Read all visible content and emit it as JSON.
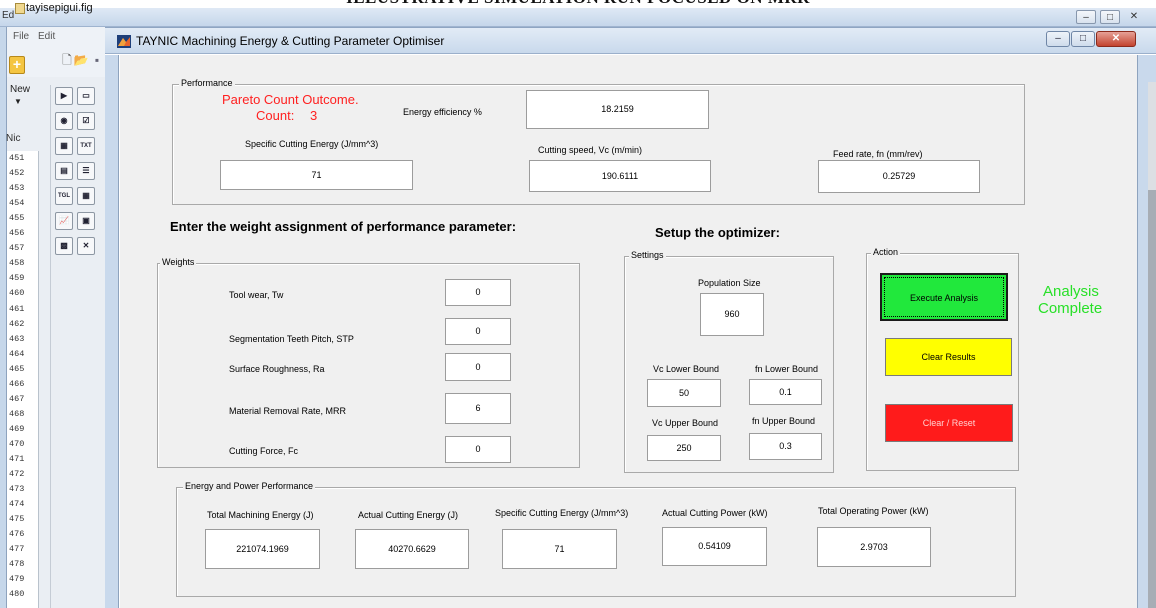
{
  "banner": {
    "text": "ILLUSTRATIVE SIMULATION RUN FOCUSED ON MRR"
  },
  "guide_window": {
    "title": "tayisepigui.fig",
    "corner_label": "Ed",
    "menu": [
      "File",
      "Edit"
    ],
    "new_label": "New",
    "nic_label": "Nic",
    "line_numbers": [
      "451",
      "452",
      "453",
      "454",
      "455",
      "456",
      "457",
      "458",
      "459",
      "460",
      "461",
      "462",
      "463",
      "464",
      "465",
      "466",
      "467",
      "468",
      "469",
      "470",
      "471",
      "472",
      "473",
      "474",
      "475",
      "476",
      "477",
      "478",
      "479",
      "480"
    ],
    "palette_icons": [
      "push-button-icon",
      "slider-icon",
      "radio-button-icon",
      "check-box-icon",
      "edit-text-icon",
      "static-text-icon",
      "popup-menu-icon",
      "listbox-icon",
      "toggle-button-icon",
      "table-icon",
      "axes-icon",
      "panel-icon",
      "button-group-icon",
      "activex-icon"
    ]
  },
  "app": {
    "title": "TAYNIC Machining Energy & Cutting Parameter Optimiser",
    "performance": {
      "panel_title": "Performance",
      "pareto_line1": "Pareto Count Outcome.",
      "pareto_line2_label": "Count:",
      "pareto_count": "3",
      "energy_efficiency_label": "Energy efficiency  %",
      "energy_efficiency_value": "18.2159",
      "specific_cutting_energy_label": "Specific Cutting Energy (J/mm^3)",
      "specific_cutting_energy_value": "71",
      "cutting_speed_label": "Cutting speed, Vc   (m/min)",
      "cutting_speed_value": "190.6111",
      "feed_rate_label": "Feed rate, fn   (mm/rev)",
      "feed_rate_value": "0.25729"
    },
    "weights_heading": "Enter the weight assignment of performance parameter:",
    "weights": {
      "panel_title": "Weights",
      "items": [
        {
          "label": "Tool wear,  Tw",
          "value": "0"
        },
        {
          "label": "Segmentation Teeth Pitch,  STP",
          "value": "0"
        },
        {
          "label": "Surface Roughness,  Ra",
          "value": "0"
        },
        {
          "label": "Material Removal Rate, MRR",
          "value": "6"
        },
        {
          "label": "Cutting Force,  Fc",
          "value": "0"
        }
      ]
    },
    "optimizer_heading": "Setup the optimizer:",
    "settings": {
      "panel_title": "Settings",
      "population_label": "Population Size",
      "population_value": "960",
      "vc_lower_label": "Vc Lower Bound",
      "vc_lower_value": "50",
      "fn_lower_label": "fn Lower Bound",
      "fn_lower_value": "0.1",
      "vc_upper_label": "Vc Upper Bound",
      "vc_upper_value": "250",
      "fn_upper_label": "fn Upper Bound",
      "fn_upper_value": "0.3"
    },
    "action": {
      "panel_title": "Action",
      "execute_label": "Execute Analysis",
      "clear_results_label": "Clear Results",
      "clear_reset_label": "Clear / Reset",
      "status_line1": "Analysis",
      "status_line2": "Complete"
    },
    "energy": {
      "panel_title": "Energy and Power Performance",
      "items": [
        {
          "label": "Total Machining Energy  (J)",
          "value": "221074.1969"
        },
        {
          "label": "Actual Cutting Energy  (J)",
          "value": "40270.6629"
        },
        {
          "label": "Specific Cutting Energy  (J/mm^3)",
          "value": "71"
        },
        {
          "label": "Actual Cutting Power  (kW)",
          "value": "0.54109"
        },
        {
          "label": "Total Operating Power  (kW)",
          "value": "2.9703"
        }
      ]
    },
    "colors": {
      "pareto_text": "#ff2020",
      "execute_button": "#21e83c",
      "clear_results_button": "#ffff00",
      "clear_reset_button": "#ff1b1b",
      "status_text": "#28e028"
    }
  }
}
